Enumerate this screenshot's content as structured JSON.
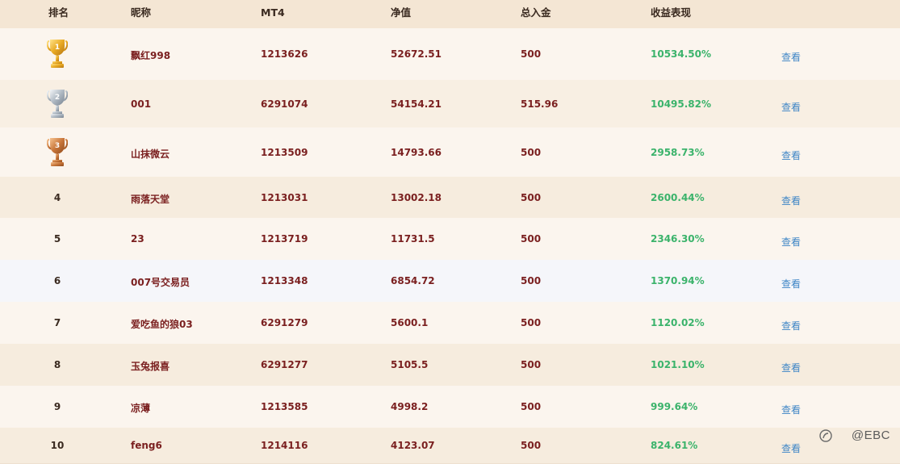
{
  "headers": {
    "rank": "排名",
    "nickname": "昵称",
    "mt4": "MT4",
    "equity": "净值",
    "deposit": "总入金",
    "performance": "收益表现"
  },
  "rows": [
    {
      "rank": "1",
      "trophy": "gold-trophy-icon",
      "nickname": "飘红998",
      "mt4": "1213626",
      "equity": "52672.51",
      "deposit": "500",
      "performance": "10534.50%",
      "action": "查看"
    },
    {
      "rank": "2",
      "trophy": "silver-trophy-icon",
      "nickname": "001",
      "mt4": "6291074",
      "equity": "54154.21",
      "deposit": "515.96",
      "performance": "10495.82%",
      "action": "查看"
    },
    {
      "rank": "3",
      "trophy": "bronze-trophy-icon",
      "nickname": "山抹微云",
      "mt4": "1213509",
      "equity": "14793.66",
      "deposit": "500",
      "performance": "2958.73%",
      "action": "查看"
    },
    {
      "rank": "4",
      "nickname": "雨落天堂",
      "mt4": "1213031",
      "equity": "13002.18",
      "deposit": "500",
      "performance": "2600.44%",
      "action": "查看"
    },
    {
      "rank": "5",
      "nickname": "23",
      "mt4": "1213719",
      "equity": "11731.5",
      "deposit": "500",
      "performance": "2346.30%",
      "action": "查看"
    },
    {
      "rank": "6",
      "nickname": "007号交易员",
      "mt4": "1213348",
      "equity": "6854.72",
      "deposit": "500",
      "performance": "1370.94%",
      "action": "查看"
    },
    {
      "rank": "7",
      "nickname": "爱吃鱼的狼03",
      "mt4": "6291279",
      "equity": "5600.1",
      "deposit": "500",
      "performance": "1120.02%",
      "action": "查看"
    },
    {
      "rank": "8",
      "nickname": "玉兔报喜",
      "mt4": "6291277",
      "equity": "5105.5",
      "deposit": "500",
      "performance": "1021.10%",
      "action": "查看"
    },
    {
      "rank": "9",
      "nickname": "凉薄",
      "mt4": "1213585",
      "equity": "4998.2",
      "deposit": "500",
      "performance": "999.64%",
      "action": "查看"
    },
    {
      "rank": "10",
      "nickname": "feng6",
      "mt4": "1214116",
      "equity": "4123.07",
      "deposit": "500",
      "performance": "824.61%",
      "action": "查看"
    }
  ],
  "watermark": "@EBC",
  "colors": {
    "header_bg": "#f4e6d4",
    "text_dark_red": "#7a1f1f",
    "gain_green": "#3bb36b",
    "link_blue": "#3f86c6"
  }
}
